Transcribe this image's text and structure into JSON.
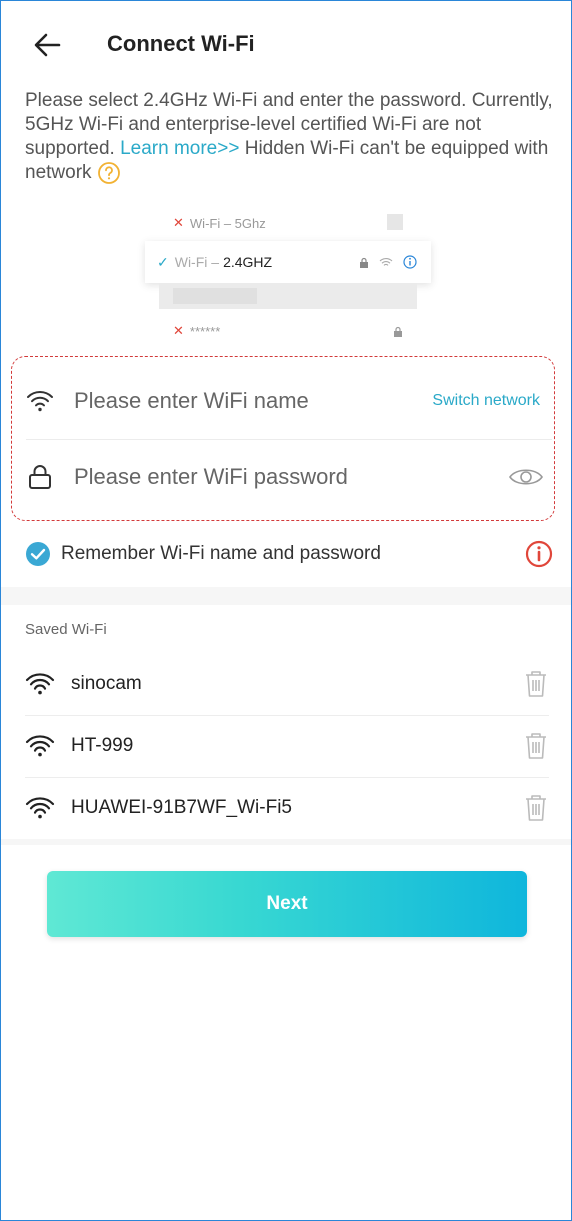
{
  "header": {
    "title": "Connect Wi-Fi"
  },
  "description": {
    "text_before_link": "Please select 2.4GHz Wi-Fi and enter the password. Currently, 5GHz Wi-Fi and enterprise-level certified Wi-Fi are not supported. ",
    "link": "Learn more>>",
    "text_after_link": " Hidden Wi-Fi can't be equipped with network"
  },
  "illustration": {
    "row1_label": "Wi-Fi – 5Ghz",
    "row2_prefix": "Wi-Fi –",
    "row2_band": "2.4GHZ",
    "row4_label": "******"
  },
  "form": {
    "wifi_name_placeholder": "Please enter WiFi name",
    "wifi_name_value": "",
    "switch_network_label": "Switch network",
    "wifi_password_placeholder": "Please enter WiFi password",
    "wifi_password_value": ""
  },
  "remember": {
    "label": "Remember Wi-Fi name and password",
    "checked": true
  },
  "saved": {
    "title": "Saved Wi-Fi",
    "items": [
      {
        "name": "sinocam"
      },
      {
        "name": "HT-999"
      },
      {
        "name": "HUAWEI-91B7WF_Wi-Fi5"
      }
    ]
  },
  "next_button": {
    "label": "Next"
  },
  "colors": {
    "accent": "#2aa9c8",
    "warning": "#e0463a",
    "dashed_border": "#d23a3a"
  }
}
